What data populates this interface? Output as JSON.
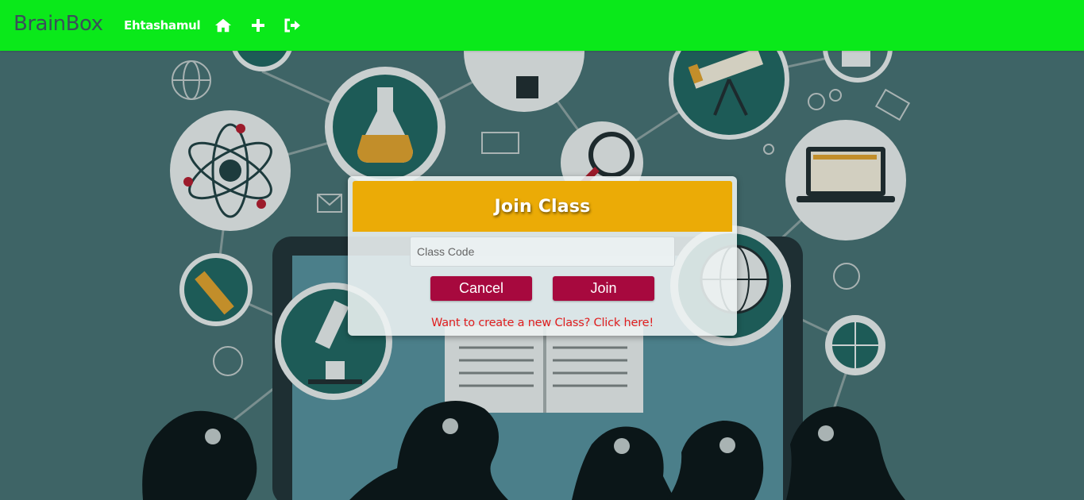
{
  "navbar": {
    "brand": "BrainBox",
    "user_name": "Ehtashamul",
    "icons": [
      "home-icon",
      "plus-icon",
      "sign-out-icon"
    ],
    "background_color": "#0ae91a"
  },
  "modal": {
    "title": "Join Class",
    "input_placeholder": "Class Code",
    "input_value": "",
    "cancel_label": "Cancel",
    "join_label": "Join",
    "create_link": "Want to create a new Class? Click here!",
    "header_color": "#ebab06",
    "button_color": "#a7093e",
    "link_color": "#e01e1e"
  },
  "background": {
    "description_icons": [
      "atom-icon",
      "flask-icon",
      "telescope-icon",
      "laptop-icon",
      "globe-icon",
      "microscope-icon",
      "pencil-icon",
      "magnifier-icon",
      "basketball-icon",
      "gear-icon",
      "envelope-icon",
      "book-icon"
    ]
  }
}
